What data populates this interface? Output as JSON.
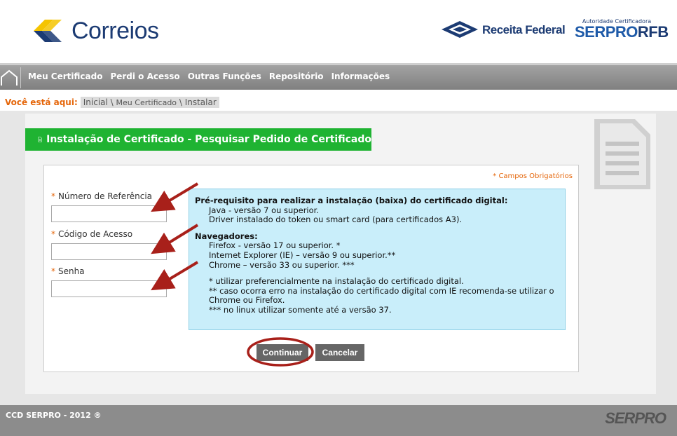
{
  "header": {
    "brand_correios": "Correios",
    "brand_receita": "Receita Federal",
    "brand_serpro_small": "Autoridade Certificadora",
    "brand_serpro_main": "SERPRO",
    "brand_serpro_suffix": "RFB"
  },
  "nav": {
    "items": [
      {
        "label": "Meu Certificado"
      },
      {
        "label": "Perdi o Acesso"
      },
      {
        "label": "Outras Funções"
      },
      {
        "label": "Repositório"
      },
      {
        "label": "Informações"
      }
    ]
  },
  "breadcrumb": {
    "prefix": "Você está aqui:",
    "crumbs": [
      "Inicial",
      "Meu Certificado",
      "Instalar"
    ],
    "separator": " \\ "
  },
  "page": {
    "title": "Instalação de Certificado - Pesquisar Pedido de Certificado",
    "required_note": "* Campos Obrigatórios"
  },
  "form": {
    "fields": [
      {
        "label": "Número de Referência",
        "value": ""
      },
      {
        "label": "Código de Acesso",
        "value": ""
      },
      {
        "label": "Senha",
        "value": ""
      }
    ],
    "required_mark": "*",
    "continue_label": "Continuar",
    "cancel_label": "Cancelar"
  },
  "info": {
    "prereq_title": "Pré-requisito para realizar a instalação (baixa) do certificado digital:",
    "prereq_items": [
      "Java - versão 7 ou superior.",
      "Driver instalado do token ou smart card (para certificados A3)."
    ],
    "browsers_title": "Navegadores:",
    "browser_items": [
      "Firefox - versão 17 ou superior. *",
      "Internet Explorer (IE) – versão 9 ou superior.**",
      "Chrome – versão 33 ou superior. ***"
    ],
    "notes": [
      "* utilizar preferencialmente na instalação do certificado digital.",
      "** caso ocorra erro na instalação do certificado digital com IE recomenda-se utilizar o Chrome ou Firefox.",
      "*** no linux utilizar somente até a versão 37."
    ]
  },
  "footer": {
    "copyright": "CCD SERPRO - 2012 ®",
    "logo": "SERPRO"
  },
  "colors": {
    "accent_green": "#1fb332",
    "orange": "#e5660a",
    "annotation_red": "#a8201a",
    "info_bg": "#c9eefa"
  }
}
